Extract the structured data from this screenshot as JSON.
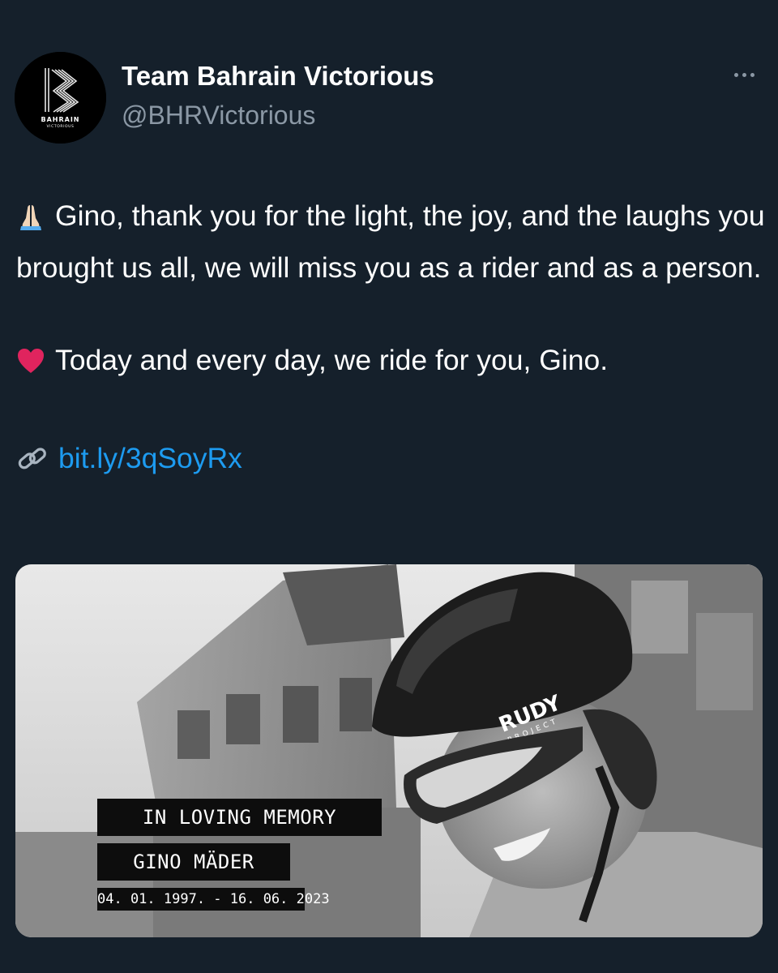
{
  "account": {
    "display_name": "Team Bahrain Victorious",
    "handle": "@BHRVictorious",
    "avatar_logo_text": [
      "BAHRAIN",
      "VICTORIOUS"
    ]
  },
  "menu": {
    "icon": "more-horizontal-icon"
  },
  "tweet": {
    "line1_emoji": "folded-hands-icon",
    "line1": "Gino, thank you for the light, the joy, and the laughs you brought us all, we will miss you as a rider and as a person.",
    "line2_emoji": "red-heart-icon",
    "line2": "Today and every day, we ride for you, Gino.",
    "link_emoji": "link-icon",
    "link_text": "bit.ly/3qSoyRx"
  },
  "media": {
    "caption_line1": "IN LOVING MEMORY",
    "caption_line2": "GINO MÄDER",
    "caption_dates": "04. 01. 1997. - 16. 06. 2023",
    "helmet_brand": "RUDY",
    "helmet_subbrand": "PROJECT"
  },
  "colors": {
    "background": "#15202b",
    "secondary_text": "#8b98a5",
    "link": "#1d9bf0",
    "heart": "#e0245e"
  }
}
